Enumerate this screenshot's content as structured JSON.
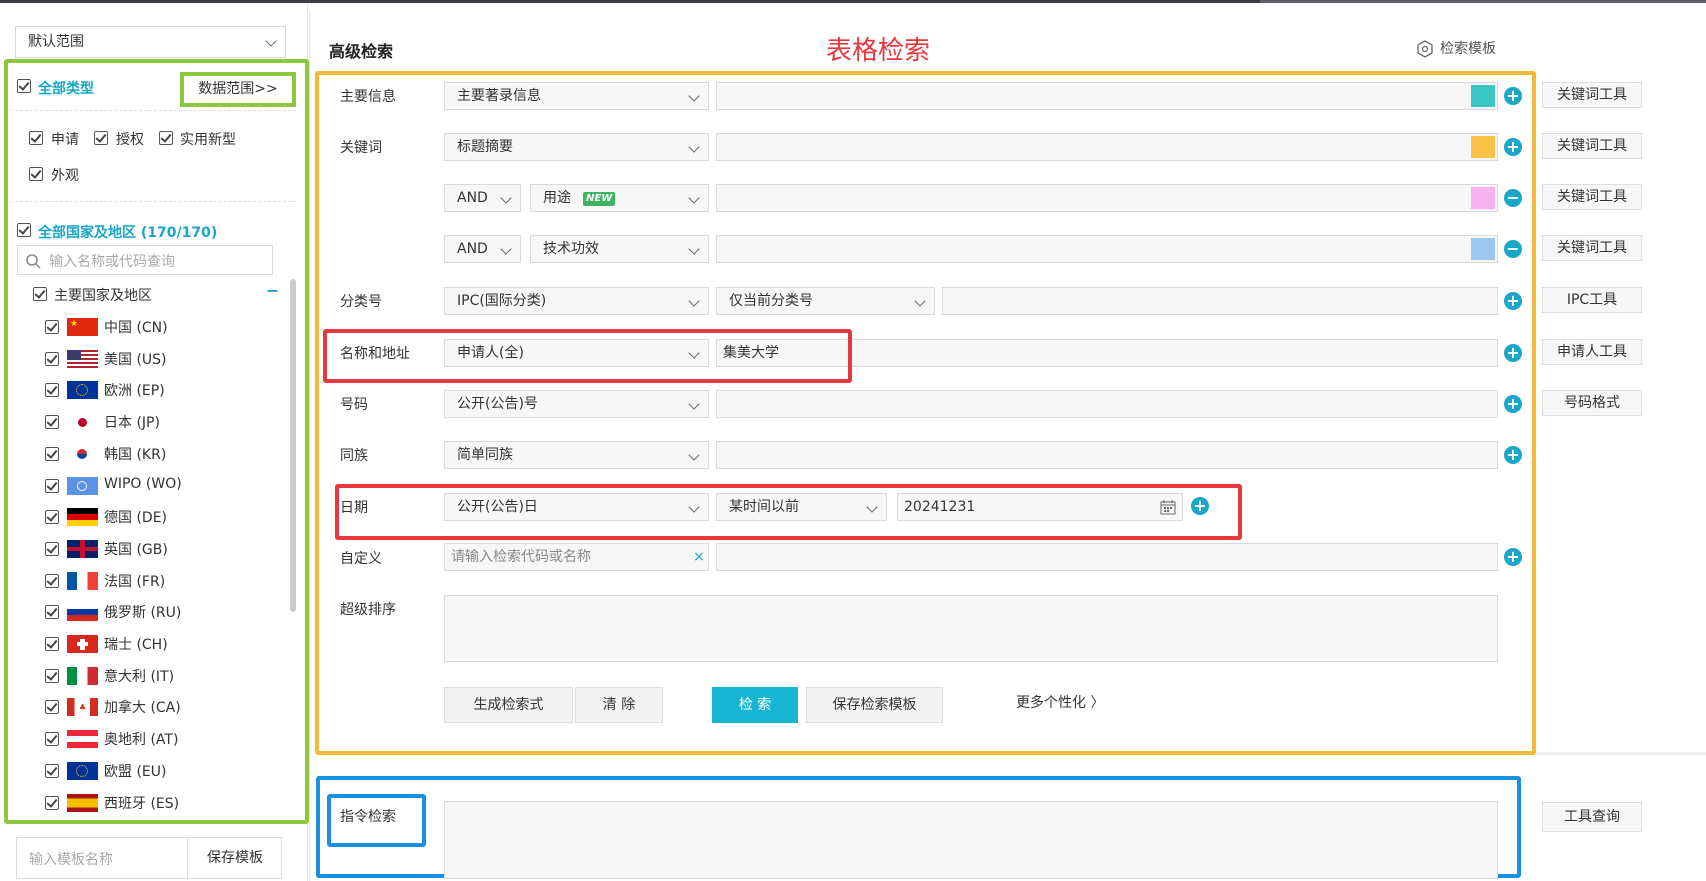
{
  "left": {
    "scope_select": "默认范围",
    "all_types": "全部类型",
    "data_range": "数据范围>>",
    "types": [
      "申请",
      "授权",
      "实用新型",
      "外观"
    ],
    "all_countries": "全部国家及地区",
    "country_count": "(170/170)",
    "search_placeholder": "输入名称或代码查询",
    "main_group": "主要国家及地区",
    "collapse": "−",
    "countries": [
      "中国 (CN)",
      "美国 (US)",
      "欧洲 (EP)",
      "日本 (JP)",
      "韩国 (KR)",
      "WIPO (WO)",
      "德国 (DE)",
      "英国 (GB)",
      "法国 (FR)",
      "俄罗斯 (RU)",
      "瑞士 (CH)",
      "意大利 (IT)",
      "加拿大 (CA)",
      "奥地利 (AT)",
      "欧盟 (EU)",
      "西班牙 (ES)"
    ],
    "template_placeholder": "输入模板名称",
    "save_template": "保存模板"
  },
  "main": {
    "title": "高级检索",
    "annotation_title": "表格检索",
    "template_link": "检索模板",
    "rows": {
      "main_info": {
        "label": "主要信息",
        "select": "主要著录信息",
        "tool": "关键词工具"
      },
      "keyword": {
        "label": "关键词",
        "select": "标题摘要",
        "tool": "关键词工具"
      },
      "kw2": {
        "op": "AND",
        "select": "用途",
        "badge": "NEW",
        "tool": "关键词工具"
      },
      "kw3": {
        "op": "AND",
        "select": "技术功效",
        "tool": "关键词工具"
      },
      "classification": {
        "label": "分类号",
        "select": "IPC(国际分类)",
        "select2": "仅当前分类号",
        "tool": "IPC工具"
      },
      "name_address": {
        "label": "名称和地址",
        "select": "申请人(全)",
        "value": "集美大学",
        "tool": "申请人工具"
      },
      "number": {
        "label": "号码",
        "select": "公开(公告)号",
        "tool": "号码格式"
      },
      "family": {
        "label": "同族",
        "select": "简单同族"
      },
      "date": {
        "label": "日期",
        "select": "公开(公告)日",
        "select2": "某时间以前",
        "value": "20241231"
      },
      "custom": {
        "label": "自定义",
        "placeholder": "请输入检索代码或名称",
        "clear": "×"
      },
      "sort": {
        "label": "超级排序"
      }
    },
    "buttons": {
      "generate": "生成检索式",
      "clear": "清 除",
      "search": "检 索",
      "save": "保存检索模板",
      "more": "更多个性化 〉"
    },
    "command": {
      "label": "指令检索",
      "tool": "工具查询"
    }
  },
  "colors": {
    "accent": "#18a6c9",
    "green_box": "#8dc63f",
    "orange_box": "#f5b93a",
    "red_box": "#e8383d",
    "blue_box": "#1a90e0",
    "swatch1": "#3cc6c2",
    "swatch2": "#f8c246",
    "swatch3": "#f6b3f0",
    "swatch4": "#9cc8f0"
  }
}
